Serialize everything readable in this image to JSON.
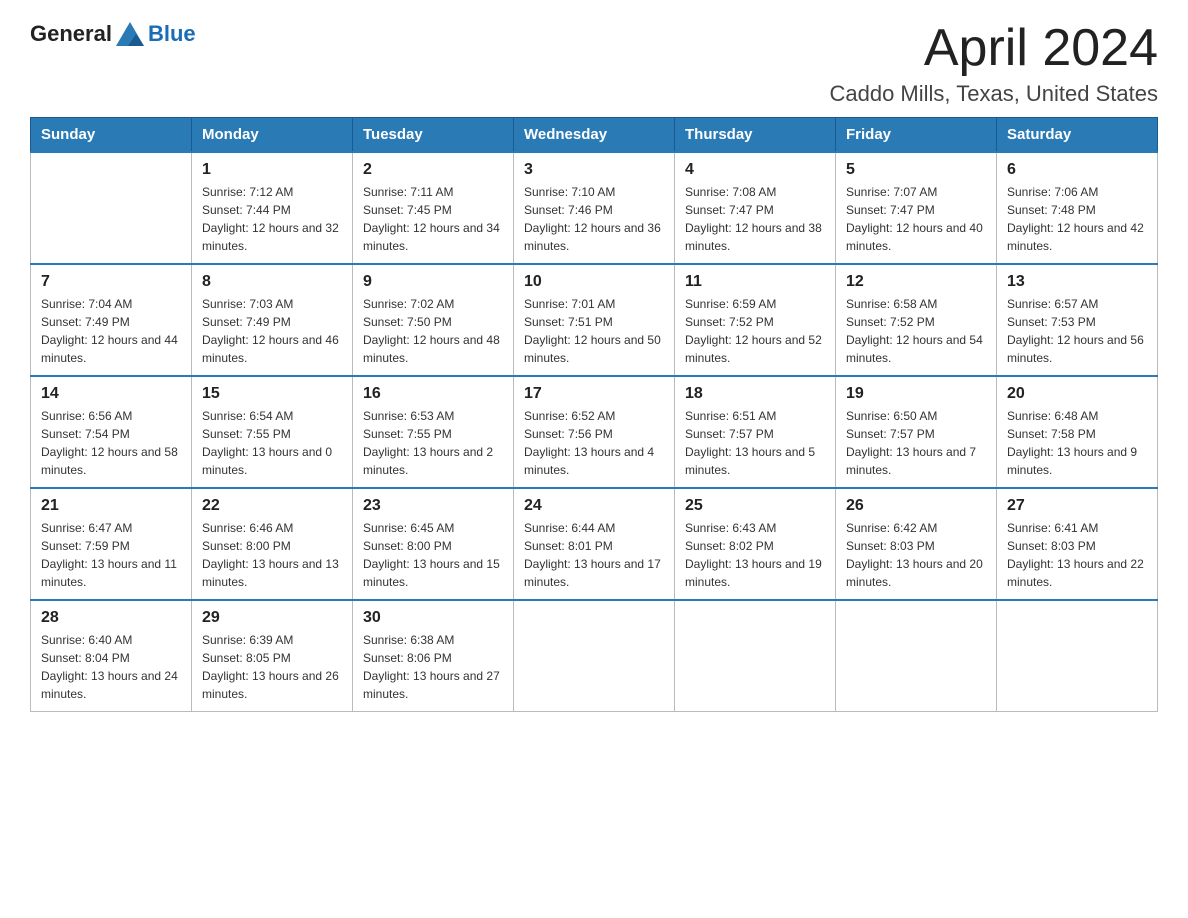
{
  "logo": {
    "general": "General",
    "blue": "Blue"
  },
  "header": {
    "month": "April 2024",
    "location": "Caddo Mills, Texas, United States"
  },
  "days": {
    "headers": [
      "Sunday",
      "Monday",
      "Tuesday",
      "Wednesday",
      "Thursday",
      "Friday",
      "Saturday"
    ]
  },
  "weeks": [
    [
      {
        "day": "",
        "sunrise": "",
        "sunset": "",
        "daylight": ""
      },
      {
        "day": "1",
        "sunrise": "Sunrise: 7:12 AM",
        "sunset": "Sunset: 7:44 PM",
        "daylight": "Daylight: 12 hours and 32 minutes."
      },
      {
        "day": "2",
        "sunrise": "Sunrise: 7:11 AM",
        "sunset": "Sunset: 7:45 PM",
        "daylight": "Daylight: 12 hours and 34 minutes."
      },
      {
        "day": "3",
        "sunrise": "Sunrise: 7:10 AM",
        "sunset": "Sunset: 7:46 PM",
        "daylight": "Daylight: 12 hours and 36 minutes."
      },
      {
        "day": "4",
        "sunrise": "Sunrise: 7:08 AM",
        "sunset": "Sunset: 7:47 PM",
        "daylight": "Daylight: 12 hours and 38 minutes."
      },
      {
        "day": "5",
        "sunrise": "Sunrise: 7:07 AM",
        "sunset": "Sunset: 7:47 PM",
        "daylight": "Daylight: 12 hours and 40 minutes."
      },
      {
        "day": "6",
        "sunrise": "Sunrise: 7:06 AM",
        "sunset": "Sunset: 7:48 PM",
        "daylight": "Daylight: 12 hours and 42 minutes."
      }
    ],
    [
      {
        "day": "7",
        "sunrise": "Sunrise: 7:04 AM",
        "sunset": "Sunset: 7:49 PM",
        "daylight": "Daylight: 12 hours and 44 minutes."
      },
      {
        "day": "8",
        "sunrise": "Sunrise: 7:03 AM",
        "sunset": "Sunset: 7:49 PM",
        "daylight": "Daylight: 12 hours and 46 minutes."
      },
      {
        "day": "9",
        "sunrise": "Sunrise: 7:02 AM",
        "sunset": "Sunset: 7:50 PM",
        "daylight": "Daylight: 12 hours and 48 minutes."
      },
      {
        "day": "10",
        "sunrise": "Sunrise: 7:01 AM",
        "sunset": "Sunset: 7:51 PM",
        "daylight": "Daylight: 12 hours and 50 minutes."
      },
      {
        "day": "11",
        "sunrise": "Sunrise: 6:59 AM",
        "sunset": "Sunset: 7:52 PM",
        "daylight": "Daylight: 12 hours and 52 minutes."
      },
      {
        "day": "12",
        "sunrise": "Sunrise: 6:58 AM",
        "sunset": "Sunset: 7:52 PM",
        "daylight": "Daylight: 12 hours and 54 minutes."
      },
      {
        "day": "13",
        "sunrise": "Sunrise: 6:57 AM",
        "sunset": "Sunset: 7:53 PM",
        "daylight": "Daylight: 12 hours and 56 minutes."
      }
    ],
    [
      {
        "day": "14",
        "sunrise": "Sunrise: 6:56 AM",
        "sunset": "Sunset: 7:54 PM",
        "daylight": "Daylight: 12 hours and 58 minutes."
      },
      {
        "day": "15",
        "sunrise": "Sunrise: 6:54 AM",
        "sunset": "Sunset: 7:55 PM",
        "daylight": "Daylight: 13 hours and 0 minutes."
      },
      {
        "day": "16",
        "sunrise": "Sunrise: 6:53 AM",
        "sunset": "Sunset: 7:55 PM",
        "daylight": "Daylight: 13 hours and 2 minutes."
      },
      {
        "day": "17",
        "sunrise": "Sunrise: 6:52 AM",
        "sunset": "Sunset: 7:56 PM",
        "daylight": "Daylight: 13 hours and 4 minutes."
      },
      {
        "day": "18",
        "sunrise": "Sunrise: 6:51 AM",
        "sunset": "Sunset: 7:57 PM",
        "daylight": "Daylight: 13 hours and 5 minutes."
      },
      {
        "day": "19",
        "sunrise": "Sunrise: 6:50 AM",
        "sunset": "Sunset: 7:57 PM",
        "daylight": "Daylight: 13 hours and 7 minutes."
      },
      {
        "day": "20",
        "sunrise": "Sunrise: 6:48 AM",
        "sunset": "Sunset: 7:58 PM",
        "daylight": "Daylight: 13 hours and 9 minutes."
      }
    ],
    [
      {
        "day": "21",
        "sunrise": "Sunrise: 6:47 AM",
        "sunset": "Sunset: 7:59 PM",
        "daylight": "Daylight: 13 hours and 11 minutes."
      },
      {
        "day": "22",
        "sunrise": "Sunrise: 6:46 AM",
        "sunset": "Sunset: 8:00 PM",
        "daylight": "Daylight: 13 hours and 13 minutes."
      },
      {
        "day": "23",
        "sunrise": "Sunrise: 6:45 AM",
        "sunset": "Sunset: 8:00 PM",
        "daylight": "Daylight: 13 hours and 15 minutes."
      },
      {
        "day": "24",
        "sunrise": "Sunrise: 6:44 AM",
        "sunset": "Sunset: 8:01 PM",
        "daylight": "Daylight: 13 hours and 17 minutes."
      },
      {
        "day": "25",
        "sunrise": "Sunrise: 6:43 AM",
        "sunset": "Sunset: 8:02 PM",
        "daylight": "Daylight: 13 hours and 19 minutes."
      },
      {
        "day": "26",
        "sunrise": "Sunrise: 6:42 AM",
        "sunset": "Sunset: 8:03 PM",
        "daylight": "Daylight: 13 hours and 20 minutes."
      },
      {
        "day": "27",
        "sunrise": "Sunrise: 6:41 AM",
        "sunset": "Sunset: 8:03 PM",
        "daylight": "Daylight: 13 hours and 22 minutes."
      }
    ],
    [
      {
        "day": "28",
        "sunrise": "Sunrise: 6:40 AM",
        "sunset": "Sunset: 8:04 PM",
        "daylight": "Daylight: 13 hours and 24 minutes."
      },
      {
        "day": "29",
        "sunrise": "Sunrise: 6:39 AM",
        "sunset": "Sunset: 8:05 PM",
        "daylight": "Daylight: 13 hours and 26 minutes."
      },
      {
        "day": "30",
        "sunrise": "Sunrise: 6:38 AM",
        "sunset": "Sunset: 8:06 PM",
        "daylight": "Daylight: 13 hours and 27 minutes."
      },
      {
        "day": "",
        "sunrise": "",
        "sunset": "",
        "daylight": ""
      },
      {
        "day": "",
        "sunrise": "",
        "sunset": "",
        "daylight": ""
      },
      {
        "day": "",
        "sunrise": "",
        "sunset": "",
        "daylight": ""
      },
      {
        "day": "",
        "sunrise": "",
        "sunset": "",
        "daylight": ""
      }
    ]
  ]
}
